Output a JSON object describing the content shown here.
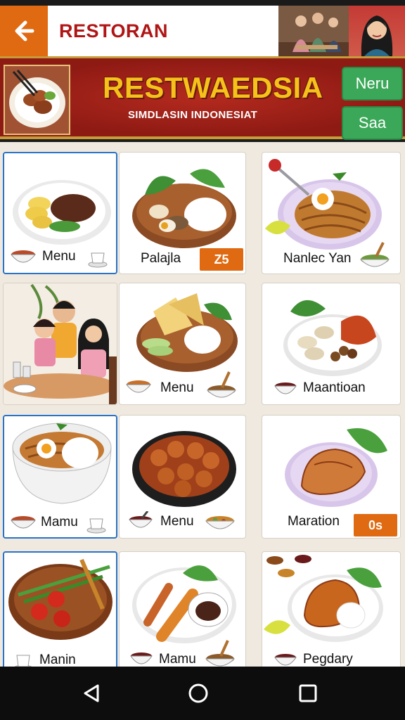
{
  "header": {
    "title": "RESTORAN"
  },
  "banner": {
    "name": "RESTWAEDSIA",
    "subtitle": "SIMDLASIN INDONESIAT",
    "buttons": [
      "Neru",
      "Saa"
    ]
  },
  "grid": {
    "cards": [
      {
        "label": "Menu"
      },
      {
        "label": "Palajla",
        "badge": "Z5"
      },
      {
        "label": "Nanlec Yan"
      },
      {
        "label": ""
      },
      {
        "label": "Menu"
      },
      {
        "label": "Maantioan"
      },
      {
        "label": "Mamu"
      },
      {
        "label": "Menu"
      },
      {
        "label": "Maration",
        "badge": "0s"
      },
      {
        "label": "Manin"
      },
      {
        "label": "Mamu"
      },
      {
        "label": "Pegdary"
      }
    ]
  },
  "colors": {
    "accent": "#e06a12",
    "title_red": "#b01515",
    "banner_red": "#9e1f17",
    "gold": "#f6c21a",
    "green": "#3aa858",
    "selection_blue": "#2a73c8"
  },
  "icons": {
    "back": "arrow-left-icon",
    "nav": [
      "nav-back-icon",
      "nav-home-icon",
      "nav-recents-icon"
    ]
  }
}
